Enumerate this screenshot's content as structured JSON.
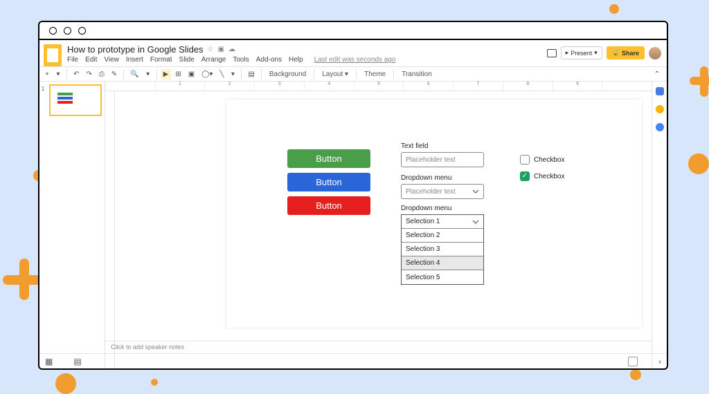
{
  "doc": {
    "title": "How to prototype in Google Slides"
  },
  "menu": [
    "File",
    "Edit",
    "View",
    "Insert",
    "Format",
    "Slide",
    "Arrange",
    "Tools",
    "Add-ons",
    "Help"
  ],
  "lastedit": "Last edit was seconds ago",
  "header": {
    "present": "Present",
    "share": "Share"
  },
  "toolbar": {
    "background": "Background",
    "layout": "Layout",
    "theme": "Theme",
    "transition": "Transition"
  },
  "ruler": [
    "",
    "1",
    "2",
    "3",
    "4",
    "5",
    "6",
    "7",
    "8",
    "9",
    ""
  ],
  "thumbs": {
    "n1": "1"
  },
  "slide": {
    "buttons": {
      "green": "Button",
      "blue": "Button",
      "red": "Button"
    },
    "textfield": {
      "label": "Text field",
      "placeholder": "Placeholder text"
    },
    "dd1": {
      "label": "Dropdown menu",
      "placeholder": "Placeholder text"
    },
    "dd2": {
      "label": "Dropdown menu",
      "options": [
        "Selection 1",
        "Selection 2",
        "Selection 3",
        "Selection 4",
        "Selection 5"
      ]
    },
    "cb1": {
      "label": "Checkbox"
    },
    "cb2": {
      "label": "Checkbox"
    }
  },
  "notes": "Click to add speaker notes"
}
